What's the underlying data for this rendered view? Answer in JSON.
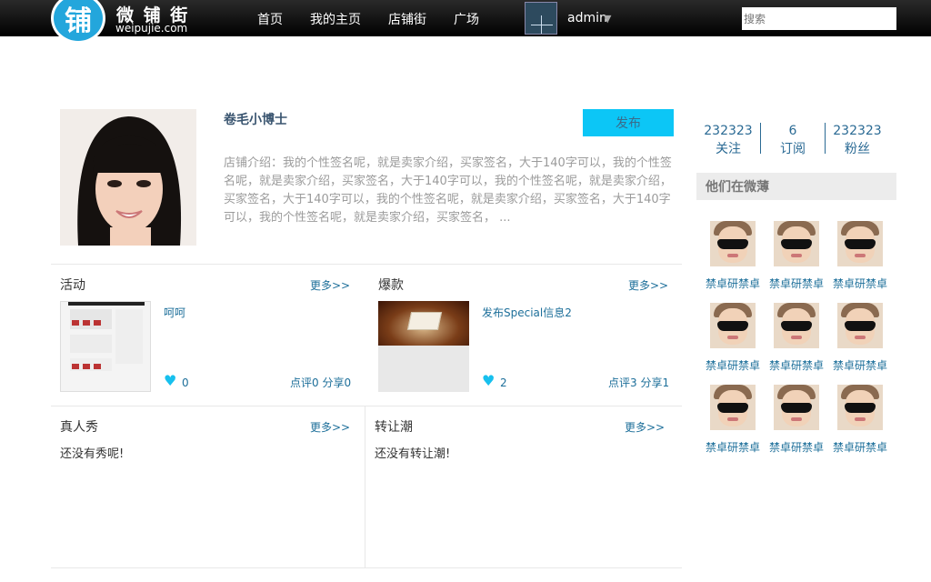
{
  "header": {
    "logo_glyph": "铺",
    "logo_name": "微 铺 街",
    "logo_domain": "weipujie.com",
    "nav": [
      "首页",
      "我的主页",
      "店铺街",
      "广场"
    ],
    "user": "admin",
    "search_placeholder": "搜索"
  },
  "shop": {
    "name": "卷毛小博士",
    "publish_label": "发布",
    "intro": "店铺介绍：我的个性签名呢，就是卖家介绍，买家签名，大于140字可以，我的个性签名呢，就是卖家介绍，买家签名，大于140字可以，我的个性签名呢，就是卖家介绍，买家签名，大于140字可以，我的个性签名呢，就是卖家介绍，买家签名，大于140字可以，我的个性签名呢，就是卖家介绍，买家签名，  ..."
  },
  "sections": {
    "activity": {
      "title": "活动",
      "more": "更多>>",
      "item_title": "呵呵",
      "likes": "0",
      "stats": "点评0 分享0"
    },
    "hot": {
      "title": "爆款",
      "more": "更多>>",
      "item_title": "发布Special信息2",
      "likes": "2",
      "stats": "点评3 分享1"
    },
    "show": {
      "title": "真人秀",
      "more": "更多>>",
      "empty": "还没有秀呢!"
    },
    "transfer": {
      "title": "转让潮",
      "more": "更多>>",
      "empty": "还没有转让潮!"
    }
  },
  "sidebar": {
    "stats": [
      {
        "num": "232323",
        "label": "关注"
      },
      {
        "num": "6",
        "label": "订阅"
      },
      {
        "num": "232323",
        "label": "粉丝"
      }
    ],
    "heading": "他们在微薄",
    "users": [
      "禁卓研禁卓",
      "禁卓研禁卓",
      "禁卓研禁卓",
      "禁卓研禁卓",
      "禁卓研禁卓",
      "禁卓研禁卓",
      "禁卓研禁卓",
      "禁卓研禁卓",
      "禁卓研禁卓"
    ]
  },
  "colors": {
    "accent": "#0cc6f6",
    "link": "#1d6f9a",
    "topbar": "#000000"
  }
}
